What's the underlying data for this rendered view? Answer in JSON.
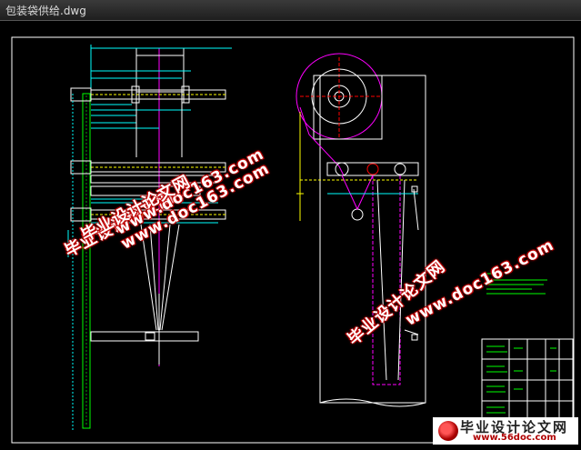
{
  "window": {
    "title": "包装袋供给.dwg"
  },
  "watermarks": [
    {
      "text": "毕业设计论文网",
      "kind": "cn"
    },
    {
      "text": "www.doc163.com",
      "kind": "url"
    },
    {
      "text": "毕业设计论文网",
      "kind": "cn"
    },
    {
      "text": "www.doc163.com",
      "kind": "url"
    },
    {
      "text": "毕业设计论文网",
      "kind": "cn"
    },
    {
      "text": "www.doc163.com",
      "kind": "url"
    }
  ],
  "logo": {
    "text": "毕业设计论文网",
    "url": "www.56doc.com"
  },
  "colors": {
    "background": "#000000",
    "line_white": "#ffffff",
    "line_green": "#00ff00",
    "line_magenta": "#ff00ff",
    "line_cyan": "#00ffff",
    "line_yellow": "#ffff00",
    "line_red": "#ff0000"
  }
}
